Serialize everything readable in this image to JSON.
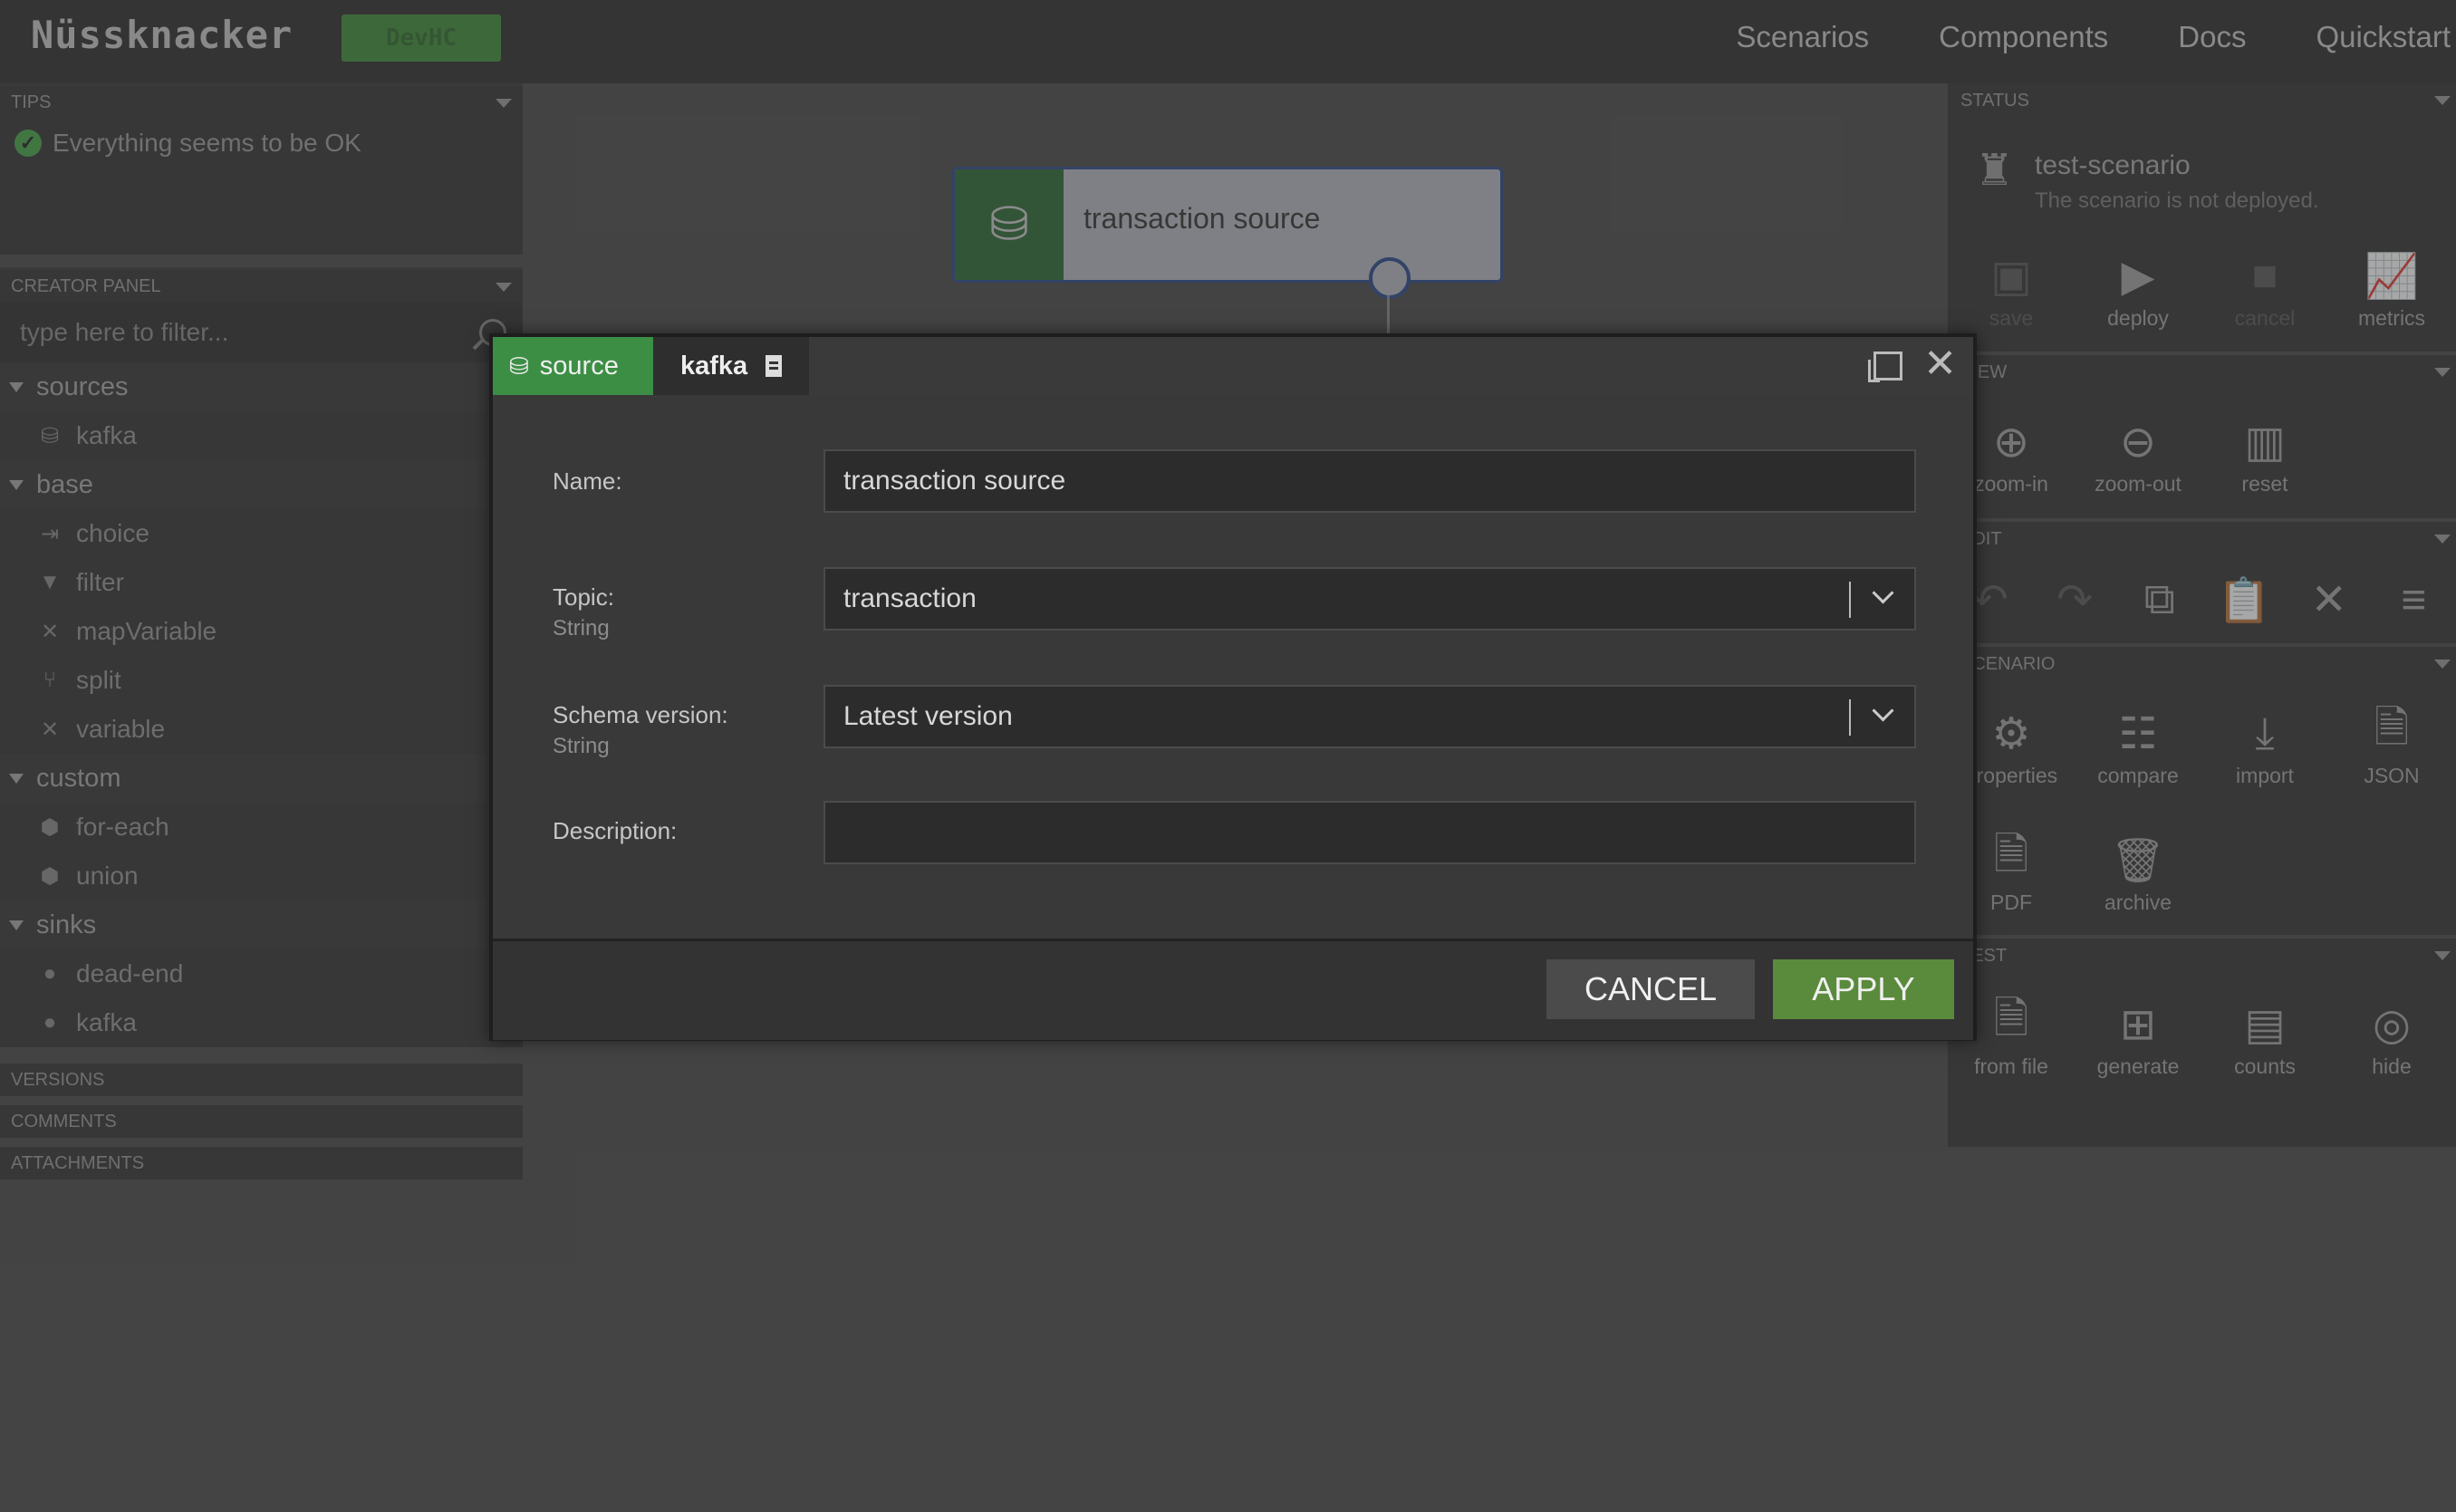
{
  "header": {
    "logo": "Nüssknacker",
    "env_badge": "DevHC",
    "nav": [
      "Scenarios",
      "Components",
      "Docs",
      "Quickstart"
    ]
  },
  "tips": {
    "title": "TIPS",
    "message": "Everything seems to be OK"
  },
  "creator_panel": {
    "title": "CREATOR PANEL",
    "filter_placeholder": "type here to filter...",
    "groups": [
      {
        "name": "sources",
        "items": [
          {
            "label": "kafka",
            "icon": "database-icon"
          }
        ]
      },
      {
        "name": "base",
        "items": [
          {
            "label": "choice",
            "icon": "choice-icon"
          },
          {
            "label": "filter",
            "icon": "filter-icon"
          },
          {
            "label": "mapVariable",
            "icon": "variable-icon"
          },
          {
            "label": "split",
            "icon": "split-icon"
          },
          {
            "label": "variable",
            "icon": "variable-icon"
          }
        ]
      },
      {
        "name": "custom",
        "items": [
          {
            "label": "for-each",
            "icon": "cube-icon"
          },
          {
            "label": "union",
            "icon": "cube-icon"
          }
        ]
      },
      {
        "name": "sinks",
        "items": [
          {
            "label": "dead-end",
            "icon": "drop-icon"
          },
          {
            "label": "kafka",
            "icon": "drop-icon"
          }
        ]
      }
    ]
  },
  "collapsed_panels": [
    "VERSIONS",
    "COMMENTS",
    "ATTACHMENTS"
  ],
  "canvas": {
    "node_label": "transaction source"
  },
  "status": {
    "title": "STATUS",
    "scenario_name": "test-scenario",
    "scenario_state": "The scenario is not deployed.",
    "buttons": [
      "save",
      "deploy",
      "cancel",
      "metrics"
    ]
  },
  "view": {
    "title": "VIEW",
    "buttons": [
      "zoom-in",
      "zoom-out",
      "reset"
    ]
  },
  "edit": {
    "title": "EDIT"
  },
  "scenario": {
    "title": "SCENARIO",
    "buttons": [
      "properties",
      "compare",
      "import",
      "JSON",
      "PDF",
      "archive"
    ]
  },
  "test": {
    "title": "TEST",
    "buttons": [
      "from file",
      "generate",
      "counts",
      "hide"
    ]
  },
  "modal": {
    "tab_type": "source",
    "tab_component": "kafka",
    "fields": {
      "name_label": "Name:",
      "name_value": "transaction source",
      "topic_label": "Topic:",
      "topic_type": "String",
      "topic_value": "transaction",
      "schema_label": "Schema version:",
      "schema_type": "String",
      "schema_value": "Latest version",
      "description_label": "Description:",
      "description_value": ""
    },
    "cancel_label": "CANCEL",
    "apply_label": "APPLY"
  },
  "colors": {
    "accent_green": "#5a8a3c",
    "source_green": "#3d8e45",
    "node_border": "#2b4a8a"
  }
}
